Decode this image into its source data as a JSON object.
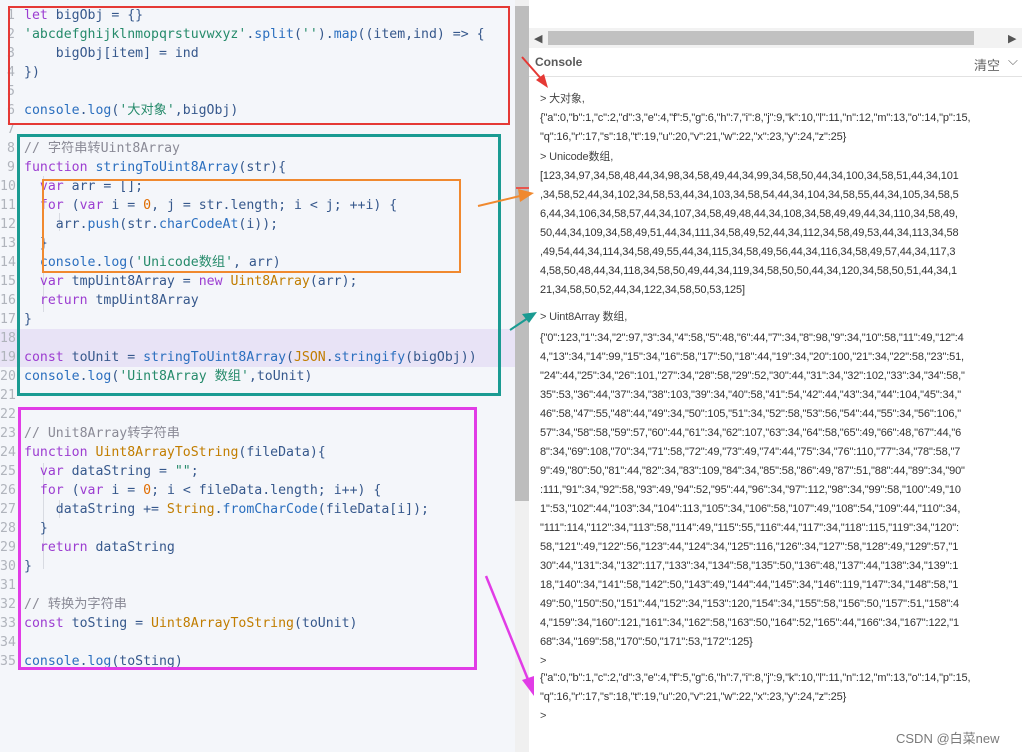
{
  "editor": {
    "lines": [
      {
        "n": "1",
        "t": [
          [
            "kw",
            "let "
          ],
          [
            "pl",
            "bigObj = {}"
          ]
        ]
      },
      {
        "n": "2",
        "t": [
          [
            "str",
            "'abcdefghijklnmopqrstuvwxyz'"
          ],
          [
            "pl",
            "."
          ],
          [
            "fn",
            "split"
          ],
          [
            "pl",
            "("
          ],
          [
            "str",
            "''"
          ],
          [
            "pl",
            ")."
          ],
          [
            "fn",
            "map"
          ],
          [
            "pl",
            "((item,ind) => {"
          ]
        ]
      },
      {
        "n": "3",
        "t": [
          [
            "pl",
            "    bigObj[item] = ind"
          ]
        ]
      },
      {
        "n": "4",
        "t": [
          [
            "pl",
            "})"
          ]
        ]
      },
      {
        "n": "5",
        "t": []
      },
      {
        "n": "6",
        "t": [
          [
            "fn",
            "console"
          ],
          [
            "pl",
            "."
          ],
          [
            "fn",
            "log"
          ],
          [
            "pl",
            "("
          ],
          [
            "str",
            "'大对象'"
          ],
          [
            "pl",
            ",bigObj)"
          ]
        ]
      },
      {
        "n": "7",
        "t": []
      },
      {
        "n": "8",
        "t": [
          [
            "cm",
            "// 字符串转Uint8Array"
          ]
        ]
      },
      {
        "n": "9",
        "t": [
          [
            "kw",
            "function "
          ],
          [
            "fn",
            "stringToUint8Array"
          ],
          [
            "pl",
            "(str){"
          ]
        ]
      },
      {
        "n": "10",
        "t": [
          [
            "kw",
            "  var "
          ],
          [
            "pl",
            "arr = [];"
          ]
        ]
      },
      {
        "n": "11",
        "t": [
          [
            "kw",
            "  for "
          ],
          [
            "pl",
            "("
          ],
          [
            "kw",
            "var "
          ],
          [
            "pl",
            "i = "
          ],
          [
            "num",
            "0"
          ],
          [
            "pl",
            ", j = str.length; i < j; ++i) {"
          ]
        ]
      },
      {
        "n": "12",
        "t": [
          [
            "pl",
            "    arr."
          ],
          [
            "fn",
            "push"
          ],
          [
            "pl",
            "(str."
          ],
          [
            "fn",
            "charCodeAt"
          ],
          [
            "pl",
            "(i));"
          ]
        ]
      },
      {
        "n": "13",
        "t": [
          [
            "pl",
            "  }"
          ]
        ]
      },
      {
        "n": "14",
        "t": [
          [
            "fn",
            "  console"
          ],
          [
            "pl",
            "."
          ],
          [
            "fn",
            "log"
          ],
          [
            "pl",
            "("
          ],
          [
            "str",
            "'Unicode数组'"
          ],
          [
            "pl",
            ", arr)"
          ]
        ]
      },
      {
        "n": "15",
        "t": [
          [
            "kw",
            "  var "
          ],
          [
            "pl",
            "tmpUint8Array = "
          ],
          [
            "kw",
            "new "
          ],
          [
            "cls",
            "Uint8Array"
          ],
          [
            "pl",
            "(arr);"
          ]
        ]
      },
      {
        "n": "16",
        "t": [
          [
            "kw",
            "  return "
          ],
          [
            "pl",
            "tmpUint8Array"
          ]
        ]
      },
      {
        "n": "17",
        "t": [
          [
            "pl",
            "}"
          ]
        ]
      },
      {
        "n": "18",
        "t": [],
        "hl": true
      },
      {
        "n": "19",
        "t": [
          [
            "kw",
            "const "
          ],
          [
            "pl",
            "toUnit = "
          ],
          [
            "fn",
            "stringToUint8Array"
          ],
          [
            "pl",
            "("
          ],
          [
            "cls",
            "JSON"
          ],
          [
            "pl",
            "."
          ],
          [
            "fn",
            "stringify"
          ],
          [
            "pl",
            "(bigObj))"
          ]
        ],
        "hl": true
      },
      {
        "n": "20",
        "t": [
          [
            "fn",
            "console"
          ],
          [
            "pl",
            "."
          ],
          [
            "fn",
            "log"
          ],
          [
            "pl",
            "("
          ],
          [
            "str",
            "'Uint8Array 数组'"
          ],
          [
            "pl",
            ",toUnit)"
          ]
        ]
      },
      {
        "n": "21",
        "t": []
      },
      {
        "n": "22",
        "t": []
      },
      {
        "n": "23",
        "t": [
          [
            "cm",
            "// Unit8Array转字符串"
          ]
        ]
      },
      {
        "n": "24",
        "t": [
          [
            "kw",
            "function "
          ],
          [
            "cls",
            "Uint8ArrayToString"
          ],
          [
            "pl",
            "(fileData){"
          ]
        ]
      },
      {
        "n": "25",
        "t": [
          [
            "kw",
            "  var "
          ],
          [
            "pl",
            "dataString = "
          ],
          [
            "str",
            "\"\""
          ],
          [
            "pl",
            ";"
          ]
        ]
      },
      {
        "n": "26",
        "t": [
          [
            "kw",
            "  for "
          ],
          [
            "pl",
            "("
          ],
          [
            "kw",
            "var "
          ],
          [
            "pl",
            "i = "
          ],
          [
            "num",
            "0"
          ],
          [
            "pl",
            "; i < fileData.length; i++) {"
          ]
        ]
      },
      {
        "n": "27",
        "t": [
          [
            "pl",
            "    dataString += "
          ],
          [
            "cls",
            "String"
          ],
          [
            "pl",
            "."
          ],
          [
            "fn",
            "fromCharCode"
          ],
          [
            "pl",
            "(fileData[i]);"
          ]
        ]
      },
      {
        "n": "28",
        "t": [
          [
            "pl",
            "  }"
          ]
        ]
      },
      {
        "n": "29",
        "t": [
          [
            "kw",
            "  return "
          ],
          [
            "pl",
            "dataString"
          ]
        ]
      },
      {
        "n": "30",
        "t": [
          [
            "pl",
            "}"
          ]
        ]
      },
      {
        "n": "31",
        "t": []
      },
      {
        "n": "32",
        "t": [
          [
            "cm",
            "// 转换为字符串"
          ]
        ]
      },
      {
        "n": "33",
        "t": [
          [
            "kw",
            "const "
          ],
          [
            "pl",
            "toSting = "
          ],
          [
            "cls",
            "Uint8ArrayToString"
          ],
          [
            "pl",
            "(toUnit)"
          ]
        ]
      },
      {
        "n": "34",
        "t": []
      },
      {
        "n": "35",
        "t": [
          [
            "fn",
            "console"
          ],
          [
            "pl",
            "."
          ],
          [
            "fn",
            "log"
          ],
          [
            "pl",
            "(toSting)"
          ]
        ]
      }
    ]
  },
  "annotations": {
    "colors": {
      "red": "#e53935",
      "teal": "#1a9b92",
      "orange": "#f0892f",
      "magenta": "#e13ce6"
    }
  },
  "console": {
    "title": "Console",
    "clear_label": "清空",
    "lines": [
      "> 大对象,",
      "{\"a\":0,\"b\":1,\"c\":2,\"d\":3,\"e\":4,\"f\":5,\"g\":6,\"h\":7,\"i\":8,\"j\":9,\"k\":10,\"l\":11,\"n\":12,\"m\":13,\"o\":14,\"p\":15,",
      "\"q\":16,\"r\":17,\"s\":18,\"t\":19,\"u\":20,\"v\":21,\"w\":22,\"x\":23,\"y\":24,\"z\":25}",
      "> Unicode数组,",
      "[123,34,97,34,58,48,44,34,98,34,58,49,44,34,99,34,58,50,44,34,100,34,58,51,44,34,101",
      ",34,58,52,44,34,102,34,58,53,44,34,103,34,58,54,44,34,104,34,58,55,44,34,105,34,58,5",
      "6,44,34,106,34,58,57,44,34,107,34,58,49,48,44,34,108,34,58,49,49,44,34,110,34,58,49,",
      "50,44,34,109,34,58,49,51,44,34,111,34,58,49,52,44,34,112,34,58,49,53,44,34,113,34,58",
      ",49,54,44,34,114,34,58,49,55,44,34,115,34,58,49,56,44,34,116,34,58,49,57,44,34,117,3",
      "4,58,50,48,44,34,118,34,58,50,49,44,34,119,34,58,50,50,44,34,120,34,58,50,51,44,34,1",
      "21,34,58,50,52,44,34,122,34,58,50,53,125]",
      "> Uint8Array 数组,",
      "{\"0\":123,\"1\":34,\"2\":97,\"3\":34,\"4\":58,\"5\":48,\"6\":44,\"7\":34,\"8\":98,\"9\":34,\"10\":58,\"11\":49,\"12\":4",
      "4,\"13\":34,\"14\":99,\"15\":34,\"16\":58,\"17\":50,\"18\":44,\"19\":34,\"20\":100,\"21\":34,\"22\":58,\"23\":51,",
      "\"24\":44,\"25\":34,\"26\":101,\"27\":34,\"28\":58,\"29\":52,\"30\":44,\"31\":34,\"32\":102,\"33\":34,\"34\":58,\"",
      "35\":53,\"36\":44,\"37\":34,\"38\":103,\"39\":34,\"40\":58,\"41\":54,\"42\":44,\"43\":34,\"44\":104,\"45\":34,\"",
      "46\":58,\"47\":55,\"48\":44,\"49\":34,\"50\":105,\"51\":34,\"52\":58,\"53\":56,\"54\":44,\"55\":34,\"56\":106,\"",
      "57\":34,\"58\":58,\"59\":57,\"60\":44,\"61\":34,\"62\":107,\"63\":34,\"64\":58,\"65\":49,\"66\":48,\"67\":44,\"6",
      "8\":34,\"69\":108,\"70\":34,\"71\":58,\"72\":49,\"73\":49,\"74\":44,\"75\":34,\"76\":110,\"77\":34,\"78\":58,\"7",
      "9\":49,\"80\":50,\"81\":44,\"82\":34,\"83\":109,\"84\":34,\"85\":58,\"86\":49,\"87\":51,\"88\":44,\"89\":34,\"90\"",
      ":111,\"91\":34,\"92\":58,\"93\":49,\"94\":52,\"95\":44,\"96\":34,\"97\":112,\"98\":34,\"99\":58,\"100\":49,\"10",
      "1\":53,\"102\":44,\"103\":34,\"104\":113,\"105\":34,\"106\":58,\"107\":49,\"108\":54,\"109\":44,\"110\":34,",
      "\"111\":114,\"112\":34,\"113\":58,\"114\":49,\"115\":55,\"116\":44,\"117\":34,\"118\":115,\"119\":34,\"120\":",
      "58,\"121\":49,\"122\":56,\"123\":44,\"124\":34,\"125\":116,\"126\":34,\"127\":58,\"128\":49,\"129\":57,\"1",
      "30\":44,\"131\":34,\"132\":117,\"133\":34,\"134\":58,\"135\":50,\"136\":48,\"137\":44,\"138\":34,\"139\":1",
      "18,\"140\":34,\"141\":58,\"142\":50,\"143\":49,\"144\":44,\"145\":34,\"146\":119,\"147\":34,\"148\":58,\"1",
      "49\":50,\"150\":50,\"151\":44,\"152\":34,\"153\":120,\"154\":34,\"155\":58,\"156\":50,\"157\":51,\"158\":4",
      "4,\"159\":34,\"160\":121,\"161\":34,\"162\":58,\"163\":50,\"164\":52,\"165\":44,\"166\":34,\"167\":122,\"1",
      "68\":34,\"169\":58,\"170\":50,\"171\":53,\"172\":125}",
      ">",
      "{\"a\":0,\"b\":1,\"c\":2,\"d\":3,\"e\":4,\"f\":5,\"g\":6,\"h\":7,\"i\":8,\"j\":9,\"k\":10,\"l\":11,\"n\":12,\"m\":13,\"o\":14,\"p\":15,",
      "\"q\":16,\"r\":17,\"s\":18,\"t\":19,\"u\":20,\"v\":21,\"w\":22,\"x\":23,\"y\":24,\"z\":25}",
      ">"
    ]
  },
  "watermark": "CSDN @白菜new"
}
